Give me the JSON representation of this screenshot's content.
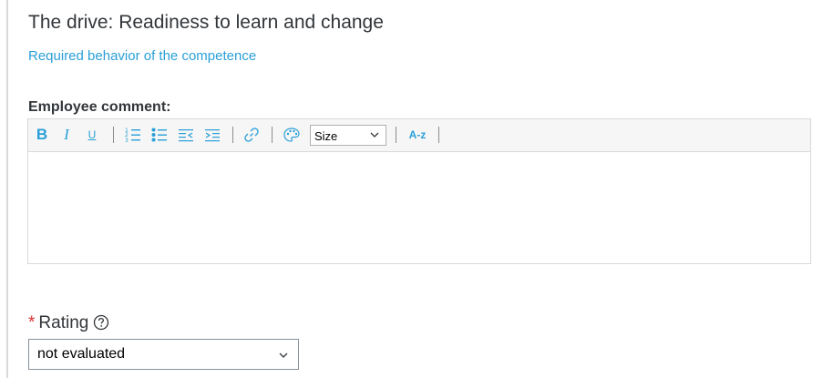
{
  "competency": {
    "title": "The drive: Readiness to learn and change",
    "behavior_link": "Required behavior of the competence"
  },
  "comment": {
    "label": "Employee comment:",
    "value": "",
    "toolbar": {
      "bold": "B",
      "italic": "I",
      "underline": "U",
      "size_value": "Size",
      "size_options": [
        "Size"
      ],
      "remove_format": "A-z",
      "icons": [
        "bold-icon",
        "italic-icon",
        "underline-icon",
        "numbered-list-icon",
        "bulleted-list-icon",
        "outdent-icon",
        "indent-icon",
        "link-icon",
        "color-palette-icon",
        "remove-format-icon"
      ]
    }
  },
  "rating": {
    "required_marker": "*",
    "label": "Rating",
    "selected": "not evaluated",
    "help_icon": "question-circle-icon"
  },
  "colors": {
    "link": "#2a9fd8",
    "required": "#e22f2f",
    "text": "#32363a",
    "toolbar_bg": "#f6f6f6",
    "border": "#d9d9d9"
  }
}
